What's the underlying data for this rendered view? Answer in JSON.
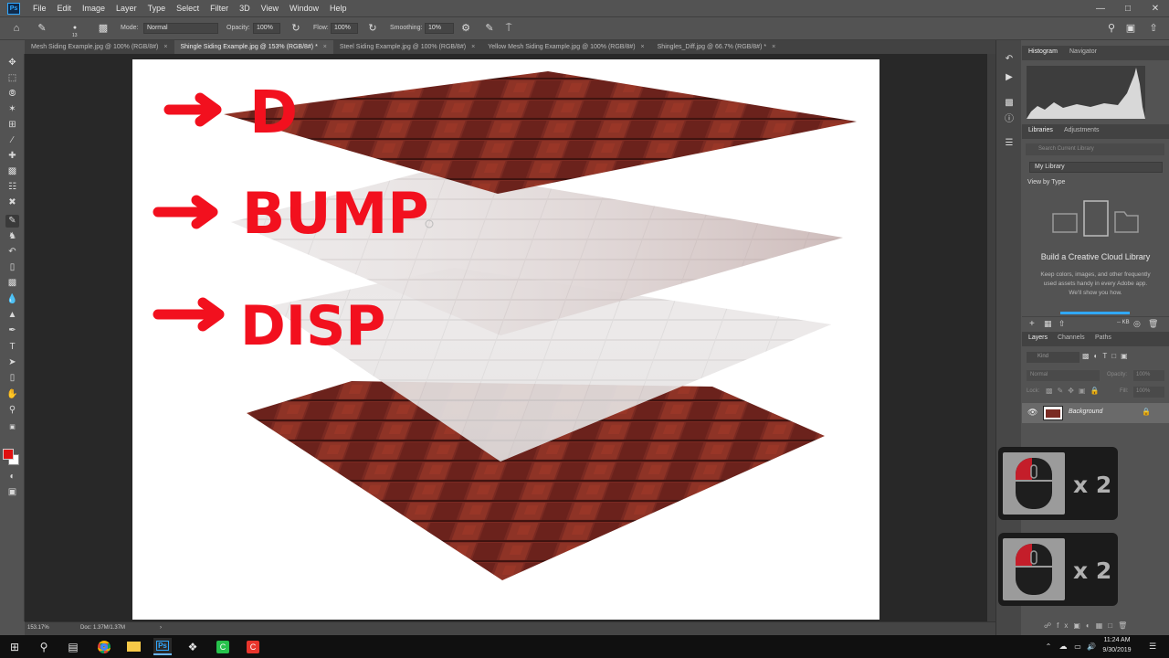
{
  "app": {
    "logo": "Ps"
  },
  "menu": [
    "File",
    "Edit",
    "Image",
    "Layer",
    "Type",
    "Select",
    "Filter",
    "3D",
    "View",
    "Window",
    "Help"
  ],
  "options": {
    "mode_label": "Mode:",
    "mode_value": "Normal",
    "opacity_label": "Opacity:",
    "opacity_value": "100%",
    "flow_label": "Flow:",
    "flow_value": "100%",
    "smoothing_label": "Smoothing:",
    "smoothing_value": "10%",
    "brush_size": "13"
  },
  "tabs": [
    {
      "label": "Mesh Siding Example.jpg @ 100% (RGB/8#)",
      "active": false
    },
    {
      "label": "Shingle Siding Example.jpg @ 153% (RGB/8#) *",
      "active": true
    },
    {
      "label": "Steel Siding Example.jpg @ 100% (RGB/8#)",
      "active": false
    },
    {
      "label": "Yellow Mesh Siding Example.jpg @ 100% (RGB/8#)",
      "active": false
    },
    {
      "label": "Shingles_Diff.jpg @ 66.7% (RGB/8#) *",
      "active": false
    }
  ],
  "tab_close": "×",
  "canvas": {
    "annotations": [
      "D",
      "BUMP",
      "DISP"
    ],
    "annotation_color": "#f2101e"
  },
  "status": {
    "zoom": "153.17%",
    "doc": "Doc: 1.37M/1.37M",
    "arrow": "›"
  },
  "histogram_panel": {
    "tabs": [
      "Histogram",
      "Navigator"
    ]
  },
  "libraries_panel": {
    "tabs": [
      "Libraries",
      "Adjustments"
    ],
    "search_placeholder": "Search Current Library",
    "library_select": "My Library",
    "view_by": "View by Type",
    "heading": "Build a Creative Cloud Library",
    "description": "Keep colors, images, and other frequently used assets handy in every Adobe app. We'll show you how.",
    "size": "-- KB"
  },
  "layers_panel": {
    "tabs": [
      "Layers",
      "Channels",
      "Paths"
    ],
    "kind_placeholder": "Kind",
    "blend_mode": "Normal",
    "opacity_label": "Opacity:",
    "opacity_value": "100%",
    "lock_label": "Lock:",
    "fill_label": "Fill:",
    "fill_value": "100%",
    "layers": [
      {
        "name": "Background",
        "visible": true,
        "locked": true
      }
    ]
  },
  "click_overlays": [
    {
      "count": "x 2"
    },
    {
      "count": "x 2"
    }
  ],
  "taskbar": {
    "time": "11:24 AM",
    "date": "9/30/2019"
  },
  "colors": {
    "foreground": "#e01010",
    "background": "#ffffff",
    "accent": "#31a8ff"
  }
}
